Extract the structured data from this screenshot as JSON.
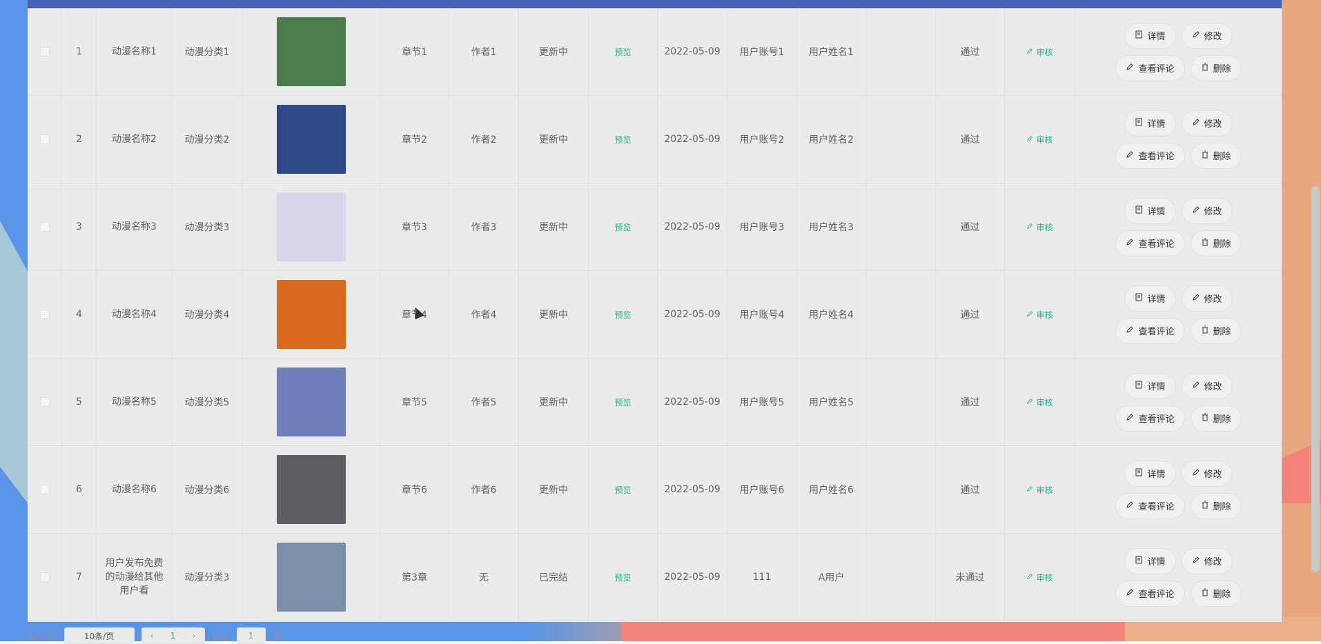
{
  "table": {
    "rows": [
      {
        "idx": "1",
        "name": "动漫名称1",
        "category": "动漫分类1",
        "chapter": "章节1",
        "author": "作者1",
        "status": "更新中",
        "preview": "预览",
        "date": "2022-05-09",
        "account": "用户账号1",
        "username": "用户姓名1",
        "review": "通过",
        "audit": "审核",
        "thumb": "#4b7c4c"
      },
      {
        "idx": "2",
        "name": "动漫名称2",
        "category": "动漫分类2",
        "chapter": "章节2",
        "author": "作者2",
        "status": "更新中",
        "preview": "预览",
        "date": "2022-05-09",
        "account": "用户账号2",
        "username": "用户姓名2",
        "review": "通过",
        "audit": "审核",
        "thumb": "#2d4a86"
      },
      {
        "idx": "3",
        "name": "动漫名称3",
        "category": "动漫分类3",
        "chapter": "章节3",
        "author": "作者3",
        "status": "更新中",
        "preview": "预览",
        "date": "2022-05-09",
        "account": "用户账号3",
        "username": "用户姓名3",
        "review": "通过",
        "audit": "审核",
        "thumb": "#d9d7ea"
      },
      {
        "idx": "4",
        "name": "动漫名称4",
        "category": "动漫分类4",
        "chapter": "章节4",
        "author": "作者4",
        "status": "更新中",
        "preview": "预览",
        "date": "2022-05-09",
        "account": "用户账号4",
        "username": "用户姓名4",
        "review": "通过",
        "audit": "审核",
        "thumb": "#d9691c"
      },
      {
        "idx": "5",
        "name": "动漫名称5",
        "category": "动漫分类5",
        "chapter": "章节5",
        "author": "作者5",
        "status": "更新中",
        "preview": "预览",
        "date": "2022-05-09",
        "account": "用户账号5",
        "username": "用户姓名5",
        "review": "通过",
        "audit": "审核",
        "thumb": "#6f7fb8"
      },
      {
        "idx": "6",
        "name": "动漫名称6",
        "category": "动漫分类6",
        "chapter": "章节6",
        "author": "作者6",
        "status": "更新中",
        "preview": "预览",
        "date": "2022-05-09",
        "account": "用户账号6",
        "username": "用户姓名6",
        "review": "通过",
        "audit": "审核",
        "thumb": "#5e5d63"
      },
      {
        "idx": "7",
        "name": "用户发布免费的动漫给其他用户看",
        "category": "动漫分类3",
        "chapter": "第3章",
        "author": "无",
        "status": "已完结",
        "preview": "预览",
        "date": "2022-05-09",
        "account": "111",
        "username": "A用户",
        "review": "未通过",
        "audit": "审核",
        "thumb": "#7a90a8"
      }
    ]
  },
  "actions": {
    "detail": "详情",
    "edit": "修改",
    "comments": "查看评论",
    "delete": "删除"
  },
  "pagination": {
    "total": "共 7 条",
    "page_size": "10条/页",
    "prev": "‹",
    "current": "1",
    "next": "›",
    "goto_label": "前往",
    "goto_value": "1",
    "page_suffix": "页"
  },
  "colors": {
    "accent": "#1ab394",
    "header": "#4561b5"
  }
}
